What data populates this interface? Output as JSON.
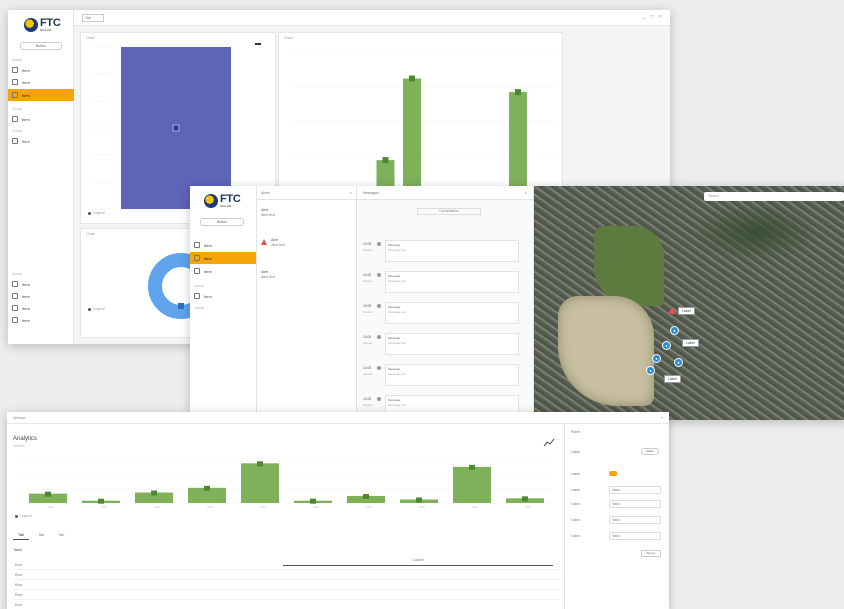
{
  "brand": {
    "name": "FTC",
    "sub": "SOLAR"
  },
  "colors": {
    "accent": "#f5a50a",
    "bar_blue": "#5e64b8",
    "bar_green": "#7fb05a",
    "pie": "#5ea3ec"
  },
  "w1": {
    "tab": "Tab",
    "window_controls": "_ □ ×",
    "sidebar": {
      "button": "Button",
      "groups": [
        "Group",
        "Group",
        "Group"
      ],
      "items": [
        "Item",
        "Item",
        "Item",
        "Item",
        "Item"
      ],
      "bottom_group": "Group",
      "bottom_items": [
        "Item",
        "Item",
        "Item",
        "Item"
      ]
    },
    "card1_title": "Chart",
    "card2_title": "Chart",
    "card3_title": "Chart",
    "legend": "Legend",
    "donut_legend": "Legend"
  },
  "w2": {
    "sidebar": {
      "button": "Button",
      "items": [
        "Item",
        "Item",
        "Item",
        "Item"
      ],
      "groups": [
        "Group",
        "Group"
      ]
    },
    "list_header": "Alerts",
    "alerts": [
      {
        "title": "Alert",
        "text": "Alert text"
      },
      {
        "title": "Alert",
        "text": "Alert text"
      },
      {
        "title": "Alert",
        "text": "Alert text"
      }
    ],
    "msg_header": "Messages",
    "msg_sub": "Conversation",
    "messages": [
      {
        "time": "10:00",
        "from": "Sender",
        "title": "Message",
        "text": "Message text"
      },
      {
        "time": "10:00",
        "from": "Sender",
        "title": "Message",
        "text": "Message text"
      },
      {
        "time": "10:00",
        "from": "Sender",
        "title": "Message",
        "text": "Message text"
      },
      {
        "time": "10:00",
        "from": "Sender",
        "title": "Message",
        "text": "Message text"
      },
      {
        "time": "10:00",
        "from": "Sender",
        "title": "Message",
        "text": "Message text"
      },
      {
        "time": "10:00",
        "from": "Sender",
        "title": "Message",
        "text": "Message text"
      }
    ],
    "map_search": "Search",
    "map_labels": [
      "Label",
      "Label",
      "Label"
    ]
  },
  "w3": {
    "title": "Window",
    "heading": "Analytics",
    "subheading": "Subtitle",
    "legend": "Legend",
    "tabs": [
      "Tab",
      "Tab",
      "Tab"
    ],
    "panel_title": "Panel",
    "panel_rows": [
      {
        "label": "Label",
        "value": "Value"
      },
      {
        "label": "Label",
        "value": "Value"
      },
      {
        "label": "Label",
        "value": "Value"
      },
      {
        "label": "Label",
        "value": "Value"
      },
      {
        "label": "Label",
        "value": "Value"
      },
      {
        "label": "Label",
        "value": "Value"
      }
    ],
    "panel_button": "Button",
    "table_header": "Table",
    "table_col2": "Column",
    "rows": [
      {
        "c1": "Row",
        "c2": ""
      },
      {
        "c1": "Row",
        "c2": ""
      },
      {
        "c1": "Row",
        "c2": ""
      },
      {
        "c1": "Row",
        "c2": ""
      },
      {
        "c1": "Row",
        "c2": ""
      }
    ]
  },
  "chart_data": [
    {
      "type": "bar",
      "categories": [
        "A"
      ],
      "values": [
        1
      ]
    },
    {
      "type": "bar",
      "categories": [
        "1",
        "2",
        "3",
        "4",
        "5",
        "6",
        "7",
        "8",
        "9",
        "10"
      ],
      "values": [
        20,
        2,
        20,
        37,
        85,
        3,
        2,
        8,
        77,
        2
      ]
    },
    {
      "type": "pie",
      "categories": [
        "A"
      ],
      "values": [
        1
      ]
    },
    {
      "type": "bar",
      "categories": [
        "1",
        "2",
        "3",
        "4",
        "5",
        "6",
        "7",
        "8",
        "9",
        "10"
      ],
      "values": [
        8,
        2,
        9,
        13,
        34,
        2,
        6,
        3,
        31,
        4
      ]
    }
  ]
}
